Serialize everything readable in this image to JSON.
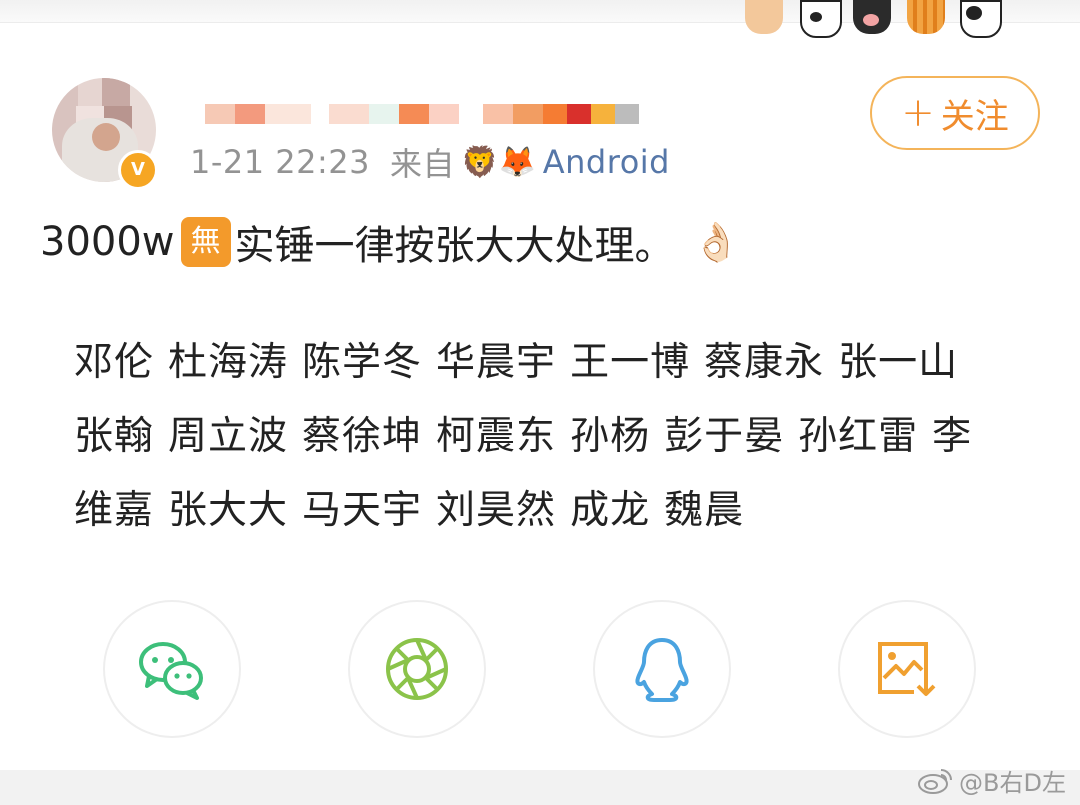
{
  "header": {
    "date_time": "1-21 22:23",
    "source_prefix": "来自",
    "source_emojis": "🦁🦊",
    "device": "Android",
    "follow_button": "关注",
    "follow_plus": "+",
    "verified_badge": "V"
  },
  "post": {
    "text_prefix": "3000w",
    "badge": "無",
    "text_main": "实锤一律按张大大处理。",
    "emoji": "👌🏻",
    "names": [
      "邓伦",
      "杜海涛",
      "陈学冬",
      "华晨宇",
      "王一博",
      "蔡康永",
      "张一山",
      "张翰",
      "周立波",
      "蔡徐坤",
      "柯震东",
      "孙杨",
      "彭于晏",
      "孙红雷",
      "李维嘉",
      "张大大",
      "马天宇",
      "刘昊然",
      "成龙",
      "魏晨"
    ]
  },
  "share": {
    "icons": [
      "wechat-icon",
      "moments-icon",
      "qq-icon",
      "save-image-icon"
    ],
    "colors": {
      "wechat": "#3dbf7a",
      "moments": "#8bc34a",
      "qq": "#4aa3e0",
      "save": "#f0a030"
    }
  },
  "watermark": {
    "text": "@B右D左"
  },
  "colors": {
    "accent": "#f08c2e",
    "device_link": "#5677a8",
    "meta_gray": "#939393"
  }
}
